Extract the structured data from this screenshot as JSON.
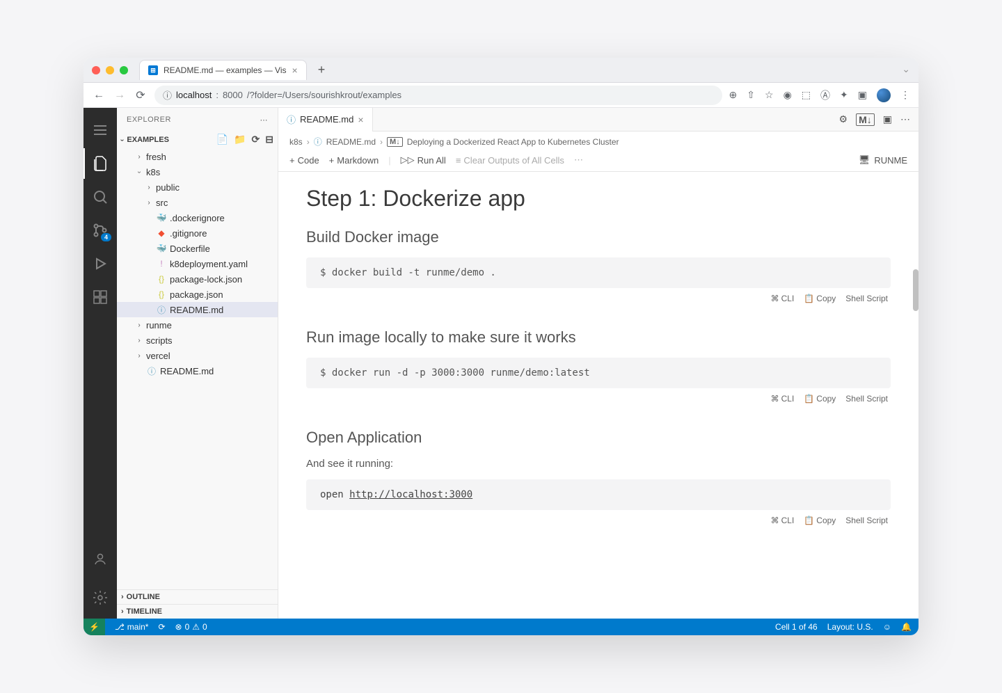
{
  "chrome": {
    "tab_title": "README.md — examples — Vis",
    "url_host": "localhost",
    "url_port": "8000",
    "url_path": "/?folder=/Users/sourishkrout/examples"
  },
  "sidebar": {
    "title": "EXPLORER",
    "section_label": "EXAMPLES",
    "outline": "OUTLINE",
    "timeline": "TIMELINE",
    "badge_scm": "4",
    "items": {
      "fresh": "fresh",
      "k8s": "k8s",
      "public": "public",
      "src": "src",
      "dockerignore": ".dockerignore",
      "gitignore": ".gitignore",
      "dockerfile": "Dockerfile",
      "k8dep": "k8deployment.yaml",
      "pkglock": "package-lock.json",
      "pkg": "package.json",
      "readme": "README.md",
      "runme": "runme",
      "scripts": "scripts",
      "vercel": "vercel",
      "readme_root": "README.md"
    }
  },
  "editor": {
    "tab_name": "README.md",
    "markdown_badge": "M↓",
    "breadcrumb": {
      "p1": "k8s",
      "p2": "README.md",
      "p3": "Deploying a Dockerized React App to Kubernetes Cluster"
    },
    "toolbar": {
      "code": "Code",
      "markdown": "Markdown",
      "run_all": "Run All",
      "clear": "Clear Outputs of All Cells",
      "runme": "RUNME"
    }
  },
  "content": {
    "h1": "Step 1: Dockerize app",
    "h2a": "Build Docker image",
    "code1": "$ docker build -t runme/demo .",
    "h2b": "Run image locally to make sure it works",
    "code2": "$ docker run -d -p 3000:3000 runme/demo:latest",
    "h2c": "Open Application",
    "para": "And see it running:",
    "code3_prefix": "open ",
    "code3_url": "http://localhost:3000",
    "cell_actions": {
      "cli": "CLI",
      "copy": "Copy",
      "shell": "Shell Script"
    }
  },
  "status": {
    "branch": "main*",
    "errors": "0",
    "warnings": "0",
    "cell": "Cell 1 of 46",
    "layout": "Layout: U.S."
  }
}
